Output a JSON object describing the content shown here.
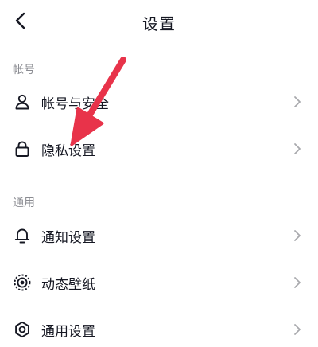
{
  "header": {
    "title": "设置",
    "back_icon": "chevron-left-icon"
  },
  "sections": [
    {
      "label": "帐号",
      "items": [
        {
          "label": "帐号与安全",
          "icon": "user-icon"
        },
        {
          "label": "隐私设置",
          "icon": "lock-icon"
        }
      ]
    },
    {
      "label": "通用",
      "items": [
        {
          "label": "通知设置",
          "icon": "bell-icon"
        },
        {
          "label": "动态壁纸",
          "icon": "live-wallpaper-icon"
        },
        {
          "label": "通用设置",
          "icon": "gear-icon"
        }
      ]
    }
  ],
  "colors": {
    "text": "#161823",
    "secondary_text": "#8a8b91",
    "chevron": "#a8a9ad",
    "divider": "#ebebed",
    "annotation_arrow": "#e8334a"
  }
}
